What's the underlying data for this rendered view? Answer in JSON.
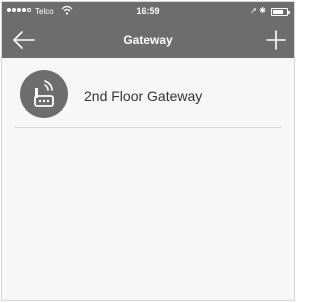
{
  "status_bar": {
    "carrier": "Telco",
    "time": "16:59",
    "location_icon": "location-arrow-icon",
    "bluetooth_icon": "bluetooth-icon",
    "battery_level": 0.8
  },
  "nav_bar": {
    "title": "Gateway",
    "back_icon": "back-arrow-icon",
    "add_icon": "plus-icon"
  },
  "gateways": [
    {
      "name": "2nd Floor Gateway",
      "icon": "router-wifi-icon"
    }
  ],
  "colors": {
    "header": "#6d6d6d",
    "background": "#f7f7f7",
    "text": "#333333"
  }
}
